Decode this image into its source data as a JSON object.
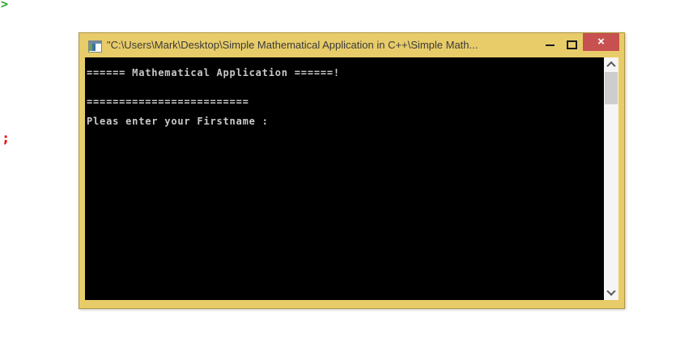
{
  "artifacts": {
    "top_left_glyph": ">",
    "left_edge_glyph": ";"
  },
  "window": {
    "title": "\"C:\\Users\\Mark\\Desktop\\Simple Mathematical Application in C++\\Simple Math...",
    "controls": {
      "minimize": "minimize",
      "maximize": "maximize",
      "close": "close",
      "close_glyph": "×"
    }
  },
  "console": {
    "lines": [
      "====== Mathematical Application ======!",
      "",
      "",
      "=========================",
      "",
      "Pleas enter your Firstname :"
    ]
  },
  "icons": {
    "app_icon": "console-window-icon",
    "minimize": "minimize-icon",
    "maximize": "maximize-icon",
    "close": "close-icon",
    "scroll_up": "chevron-up-icon",
    "scroll_down": "chevron-down-icon"
  },
  "colors": {
    "frame": "#e8cc69",
    "frame_border": "#b19744",
    "titlebar_text": "#3a3a3a",
    "close_button": "#c75050",
    "console_background": "#000000",
    "console_text": "#c9c9c9",
    "scrollbar_track": "#f5f5f5",
    "scrollbar_thumb": "#cdcdcd",
    "artifact_green": "#28a228",
    "artifact_red": "#ee0000"
  }
}
